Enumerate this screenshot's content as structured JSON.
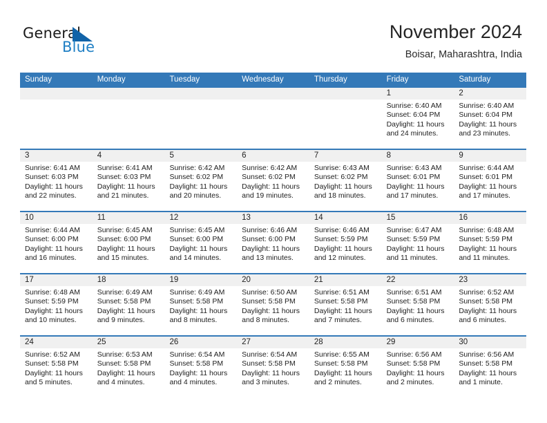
{
  "brand": {
    "word1": "General",
    "word2": "Blue",
    "triangle_color": "#1163a8",
    "blue_text_color": "#1f7fc4"
  },
  "header": {
    "title": "November 2024",
    "location": "Boisar, Maharashtra, India"
  },
  "theme": {
    "header_bar_color": "#3479b8",
    "daynum_band_color": "#f0f0f0",
    "cell_background": "#ffffff",
    "text_color": "#1d1d1d"
  },
  "weekdays": [
    "Sunday",
    "Monday",
    "Tuesday",
    "Wednesday",
    "Thursday",
    "Friday",
    "Saturday"
  ],
  "labels": {
    "sunrise": "Sunrise:",
    "sunset": "Sunset:",
    "daylight": "Daylight:"
  },
  "weeks": [
    {
      "days": [
        {
          "num": "",
          "sunrise": "",
          "sunset": "",
          "daylight_line1": "",
          "daylight_line2": ""
        },
        {
          "num": "",
          "sunrise": "",
          "sunset": "",
          "daylight_line1": "",
          "daylight_line2": ""
        },
        {
          "num": "",
          "sunrise": "",
          "sunset": "",
          "daylight_line1": "",
          "daylight_line2": ""
        },
        {
          "num": "",
          "sunrise": "",
          "sunset": "",
          "daylight_line1": "",
          "daylight_line2": ""
        },
        {
          "num": "",
          "sunrise": "",
          "sunset": "",
          "daylight_line1": "",
          "daylight_line2": ""
        },
        {
          "num": "1",
          "sunrise": "Sunrise: 6:40 AM",
          "sunset": "Sunset: 6:04 PM",
          "daylight_line1": "Daylight: 11 hours",
          "daylight_line2": "and 24 minutes."
        },
        {
          "num": "2",
          "sunrise": "Sunrise: 6:40 AM",
          "sunset": "Sunset: 6:04 PM",
          "daylight_line1": "Daylight: 11 hours",
          "daylight_line2": "and 23 minutes."
        }
      ]
    },
    {
      "days": [
        {
          "num": "3",
          "sunrise": "Sunrise: 6:41 AM",
          "sunset": "Sunset: 6:03 PM",
          "daylight_line1": "Daylight: 11 hours",
          "daylight_line2": "and 22 minutes."
        },
        {
          "num": "4",
          "sunrise": "Sunrise: 6:41 AM",
          "sunset": "Sunset: 6:03 PM",
          "daylight_line1": "Daylight: 11 hours",
          "daylight_line2": "and 21 minutes."
        },
        {
          "num": "5",
          "sunrise": "Sunrise: 6:42 AM",
          "sunset": "Sunset: 6:02 PM",
          "daylight_line1": "Daylight: 11 hours",
          "daylight_line2": "and 20 minutes."
        },
        {
          "num": "6",
          "sunrise": "Sunrise: 6:42 AM",
          "sunset": "Sunset: 6:02 PM",
          "daylight_line1": "Daylight: 11 hours",
          "daylight_line2": "and 19 minutes."
        },
        {
          "num": "7",
          "sunrise": "Sunrise: 6:43 AM",
          "sunset": "Sunset: 6:02 PM",
          "daylight_line1": "Daylight: 11 hours",
          "daylight_line2": "and 18 minutes."
        },
        {
          "num": "8",
          "sunrise": "Sunrise: 6:43 AM",
          "sunset": "Sunset: 6:01 PM",
          "daylight_line1": "Daylight: 11 hours",
          "daylight_line2": "and 17 minutes."
        },
        {
          "num": "9",
          "sunrise": "Sunrise: 6:44 AM",
          "sunset": "Sunset: 6:01 PM",
          "daylight_line1": "Daylight: 11 hours",
          "daylight_line2": "and 17 minutes."
        }
      ]
    },
    {
      "days": [
        {
          "num": "10",
          "sunrise": "Sunrise: 6:44 AM",
          "sunset": "Sunset: 6:00 PM",
          "daylight_line1": "Daylight: 11 hours",
          "daylight_line2": "and 16 minutes."
        },
        {
          "num": "11",
          "sunrise": "Sunrise: 6:45 AM",
          "sunset": "Sunset: 6:00 PM",
          "daylight_line1": "Daylight: 11 hours",
          "daylight_line2": "and 15 minutes."
        },
        {
          "num": "12",
          "sunrise": "Sunrise: 6:45 AM",
          "sunset": "Sunset: 6:00 PM",
          "daylight_line1": "Daylight: 11 hours",
          "daylight_line2": "and 14 minutes."
        },
        {
          "num": "13",
          "sunrise": "Sunrise: 6:46 AM",
          "sunset": "Sunset: 6:00 PM",
          "daylight_line1": "Daylight: 11 hours",
          "daylight_line2": "and 13 minutes."
        },
        {
          "num": "14",
          "sunrise": "Sunrise: 6:46 AM",
          "sunset": "Sunset: 5:59 PM",
          "daylight_line1": "Daylight: 11 hours",
          "daylight_line2": "and 12 minutes."
        },
        {
          "num": "15",
          "sunrise": "Sunrise: 6:47 AM",
          "sunset": "Sunset: 5:59 PM",
          "daylight_line1": "Daylight: 11 hours",
          "daylight_line2": "and 11 minutes."
        },
        {
          "num": "16",
          "sunrise": "Sunrise: 6:48 AM",
          "sunset": "Sunset: 5:59 PM",
          "daylight_line1": "Daylight: 11 hours",
          "daylight_line2": "and 11 minutes."
        }
      ]
    },
    {
      "days": [
        {
          "num": "17",
          "sunrise": "Sunrise: 6:48 AM",
          "sunset": "Sunset: 5:59 PM",
          "daylight_line1": "Daylight: 11 hours",
          "daylight_line2": "and 10 minutes."
        },
        {
          "num": "18",
          "sunrise": "Sunrise: 6:49 AM",
          "sunset": "Sunset: 5:58 PM",
          "daylight_line1": "Daylight: 11 hours",
          "daylight_line2": "and 9 minutes."
        },
        {
          "num": "19",
          "sunrise": "Sunrise: 6:49 AM",
          "sunset": "Sunset: 5:58 PM",
          "daylight_line1": "Daylight: 11 hours",
          "daylight_line2": "and 8 minutes."
        },
        {
          "num": "20",
          "sunrise": "Sunrise: 6:50 AM",
          "sunset": "Sunset: 5:58 PM",
          "daylight_line1": "Daylight: 11 hours",
          "daylight_line2": "and 8 minutes."
        },
        {
          "num": "21",
          "sunrise": "Sunrise: 6:51 AM",
          "sunset": "Sunset: 5:58 PM",
          "daylight_line1": "Daylight: 11 hours",
          "daylight_line2": "and 7 minutes."
        },
        {
          "num": "22",
          "sunrise": "Sunrise: 6:51 AM",
          "sunset": "Sunset: 5:58 PM",
          "daylight_line1": "Daylight: 11 hours",
          "daylight_line2": "and 6 minutes."
        },
        {
          "num": "23",
          "sunrise": "Sunrise: 6:52 AM",
          "sunset": "Sunset: 5:58 PM",
          "daylight_line1": "Daylight: 11 hours",
          "daylight_line2": "and 6 minutes."
        }
      ]
    },
    {
      "days": [
        {
          "num": "24",
          "sunrise": "Sunrise: 6:52 AM",
          "sunset": "Sunset: 5:58 PM",
          "daylight_line1": "Daylight: 11 hours",
          "daylight_line2": "and 5 minutes."
        },
        {
          "num": "25",
          "sunrise": "Sunrise: 6:53 AM",
          "sunset": "Sunset: 5:58 PM",
          "daylight_line1": "Daylight: 11 hours",
          "daylight_line2": "and 4 minutes."
        },
        {
          "num": "26",
          "sunrise": "Sunrise: 6:54 AM",
          "sunset": "Sunset: 5:58 PM",
          "daylight_line1": "Daylight: 11 hours",
          "daylight_line2": "and 4 minutes."
        },
        {
          "num": "27",
          "sunrise": "Sunrise: 6:54 AM",
          "sunset": "Sunset: 5:58 PM",
          "daylight_line1": "Daylight: 11 hours",
          "daylight_line2": "and 3 minutes."
        },
        {
          "num": "28",
          "sunrise": "Sunrise: 6:55 AM",
          "sunset": "Sunset: 5:58 PM",
          "daylight_line1": "Daylight: 11 hours",
          "daylight_line2": "and 2 minutes."
        },
        {
          "num": "29",
          "sunrise": "Sunrise: 6:56 AM",
          "sunset": "Sunset: 5:58 PM",
          "daylight_line1": "Daylight: 11 hours",
          "daylight_line2": "and 2 minutes."
        },
        {
          "num": "30",
          "sunrise": "Sunrise: 6:56 AM",
          "sunset": "Sunset: 5:58 PM",
          "daylight_line1": "Daylight: 11 hours",
          "daylight_line2": "and 1 minute."
        }
      ]
    }
  ]
}
